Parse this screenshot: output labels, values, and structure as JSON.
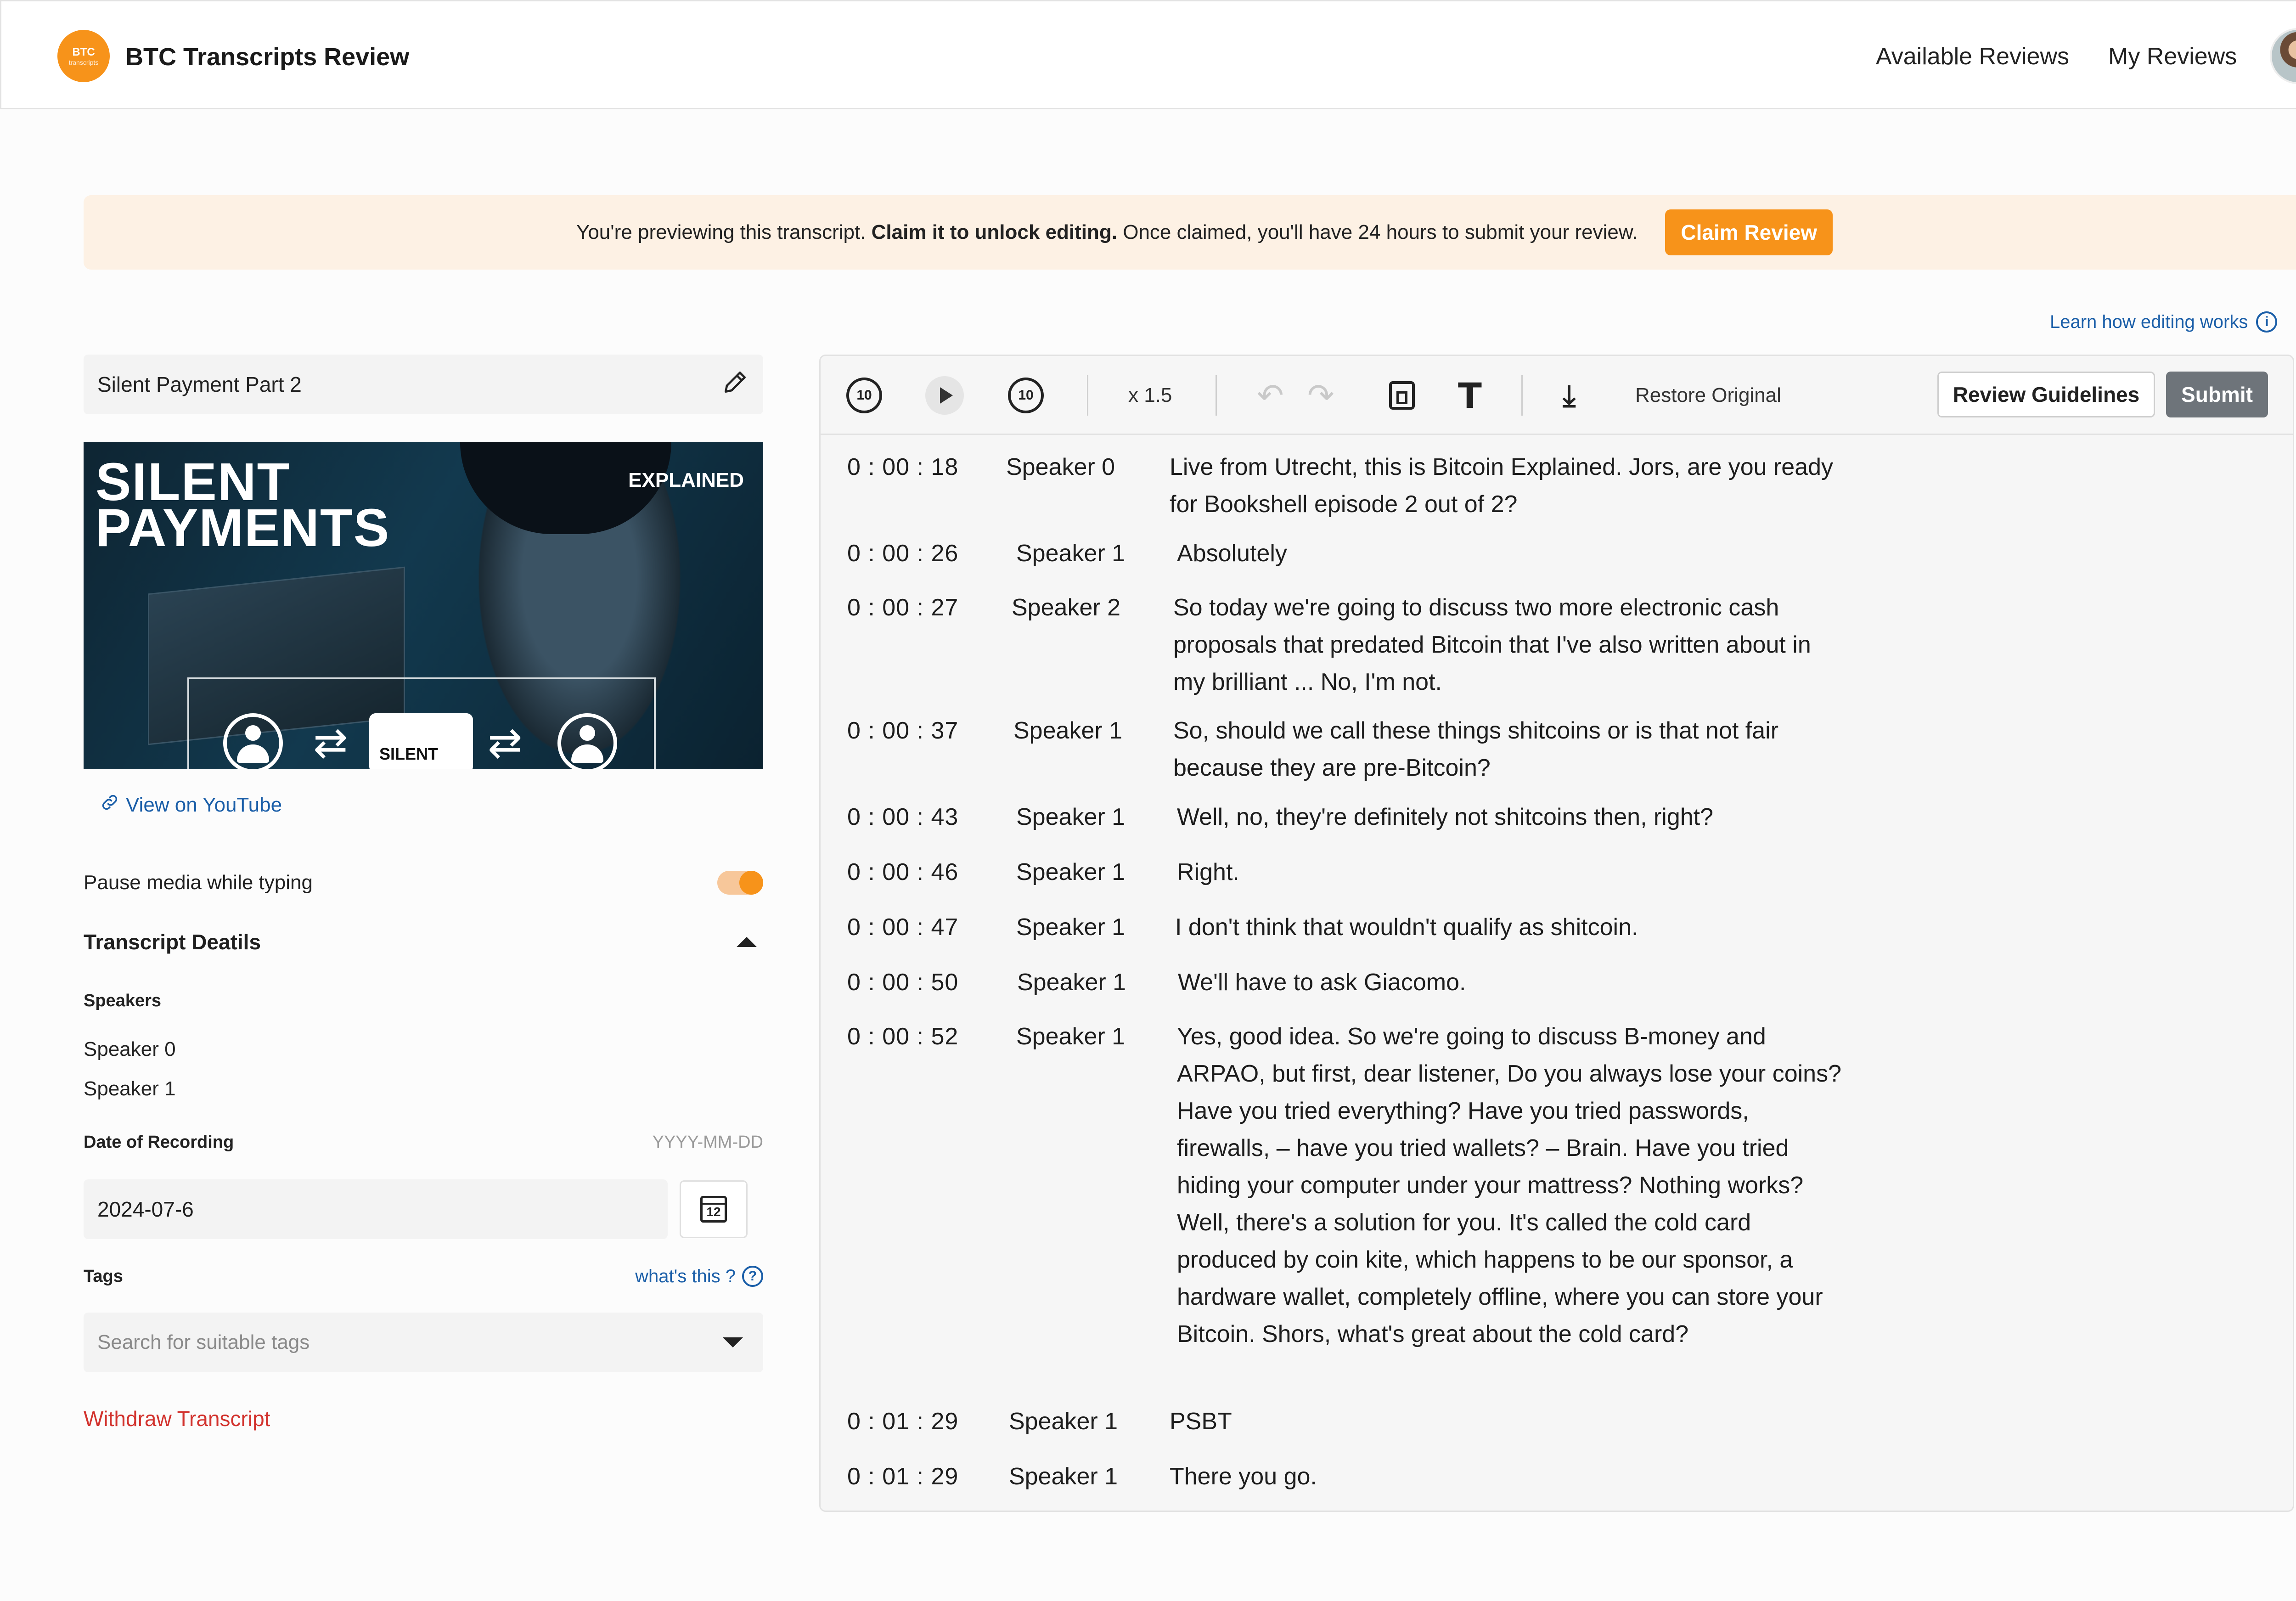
{
  "header": {
    "logo_line1": "BTC",
    "logo_line2": "transcripts",
    "title": "BTC Transcripts Review",
    "nav": [
      "Available Reviews",
      "My Reviews"
    ]
  },
  "banner": {
    "text_pre": "You're previewing this transcript. ",
    "text_bold": "Claim it to unlock editing.",
    "text_post": " Once claimed, you'll have 24 hours to submit your review.",
    "button": "Claim Review"
  },
  "learn_link": "Learn how editing works",
  "sidebar": {
    "title": "Silent Payment Part 2",
    "thumbnail": {
      "headline_line1": "SILENT",
      "headline_line2": "PAYMENTS",
      "badge": "EXPLAINED",
      "wallet_label": "SILENT"
    },
    "youtube_link": "View on YouTube",
    "pause_label": "Pause media while typing",
    "pause_enabled": true,
    "details_heading": "Transcript Deatils",
    "speakers_label": "Speakers",
    "speakers": [
      "Speaker 0",
      "Speaker 1"
    ],
    "date_label": "Date of Recording",
    "date_format": "YYYY-MM-DD",
    "date_value": "2024-07-6",
    "calendar_day": "12",
    "tags_label": "Tags",
    "whats_this": "what's this ?",
    "tags_placeholder": "Search for suitable tags",
    "withdraw": "Withdraw Transcript"
  },
  "toolbar": {
    "rewind_label": "10",
    "forward_label": "10",
    "speed": "x 1.5",
    "restore": "Restore Original",
    "guidelines": "Review Guidelines",
    "submit": "Submit"
  },
  "transcript": [
    {
      "time": "0 : 00 : 18",
      "speaker": "Speaker 0",
      "text": "Live from Utrecht, this is Bitcoin Explained. Jors, are you ready for Bookshell episode 2 out of 2?"
    },
    {
      "time": "0 : 00 : 26",
      "speaker": "Speaker 1",
      "text": "Absolutely"
    },
    {
      "time": "0 : 00 : 27",
      "speaker": "Speaker 2",
      "text": "So today we're going to discuss two more electronic cash proposals that predated Bitcoin that I've also written about in my brilliant ... No, I'm not."
    },
    {
      "time": "0 : 00 : 37",
      "speaker": "Speaker 1",
      "text": "So, should we call these things shitcoins or is that not fair because they are pre-Bitcoin?"
    },
    {
      "time": "0 : 00 : 43",
      "speaker": "Speaker 1",
      "text": "Well, no, they're definitely not shitcoins then, right?"
    },
    {
      "time": "0 : 00 : 46",
      "speaker": "Speaker 1",
      "text": "Right."
    },
    {
      "time": "0 : 00 : 47",
      "speaker": "Speaker 1",
      "text": "I don't think that wouldn't qualify as shitcoin."
    },
    {
      "time": "0 : 00 : 50",
      "speaker": "Speaker 1",
      "text": "We'll have to ask Giacomo."
    },
    {
      "time": "0 : 00 : 52",
      "speaker": "Speaker 1",
      "text": "Yes, good idea. So we're going to discuss B-money and ARPAO, but first, dear listener, Do you always lose your coins? Have you tried everything? Have you tried passwords, firewalls, – have you tried wallets? – Brain. Have you tried hiding your computer under your mattress? Nothing works? Well, there's a solution for you. It's called the cold card produced by coin kite, which happens to be our sponsor, a hardware wallet, completely offline, where you can store your Bitcoin. Shors, what's great about the cold card?"
    },
    {
      "time": "0 : 01 : 29",
      "speaker": "Speaker 1",
      "text": "PSBT"
    },
    {
      "time": "0 : 01 : 29",
      "speaker": "Speaker 1",
      "text": "There you go."
    }
  ]
}
